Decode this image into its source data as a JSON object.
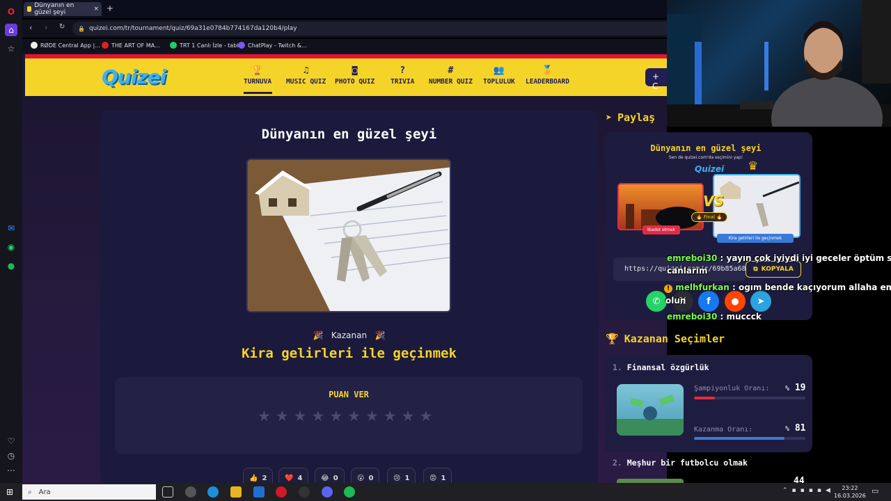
{
  "browser": {
    "tab_title": "Dünyanın en güzel şeyi",
    "url": "quizei.com/tr/tournament/quiz/69a31e0784b774167da120b4/play",
    "bookmarks": [
      "RØDE Central App |...",
      "THE ART OF MA...",
      "TRT 1 Canlı İzle - tabii",
      "ChatPlay - Twitch &..."
    ]
  },
  "site": {
    "logo": "Quizei",
    "nav": [
      {
        "icon": "trophy-icon",
        "glyph": "🏆",
        "label": "TURNUVA"
      },
      {
        "icon": "music-icon",
        "glyph": "♫",
        "label": "MUSIC QUIZ"
      },
      {
        "icon": "camera-icon",
        "glyph": "◙",
        "label": "PHOTO QUIZ"
      },
      {
        "icon": "question-icon",
        "glyph": "?",
        "label": "TRIVIA"
      },
      {
        "icon": "hash-icon",
        "glyph": "#",
        "label": "NUMBER QUIZ"
      },
      {
        "icon": "users-icon",
        "glyph": "👥",
        "label": "TOPLULUK"
      },
      {
        "icon": "medal-icon",
        "glyph": "🏅",
        "label": "LEADERBOARD"
      }
    ],
    "create_glyph": "+ C"
  },
  "quiz": {
    "title": "Dünyanın en güzel şeyi",
    "winner_label": "Kazanan",
    "winner": "Kira gelirleri ile geçinmek",
    "rate_label": "PUAN VER",
    "stars": 10,
    "reactions": [
      {
        "emoji": "👍",
        "count": "2"
      },
      {
        "emoji": "❤️",
        "count": "4"
      },
      {
        "emoji": "😂",
        "count": "0"
      },
      {
        "emoji": "😮",
        "count": "0"
      },
      {
        "emoji": "😢",
        "count": "1"
      },
      {
        "emoji": "😡",
        "count": "1"
      }
    ]
  },
  "share": {
    "header": "Paylaş",
    "preview_title": "Dünyanın en güzel şeyi",
    "preview_subtitle": "Sen de quizei.com'da seçimini yap!",
    "preview_logo": "Quizei",
    "vs": "VS",
    "final_badge": "🔥 Final 🔥",
    "left_label": "İbadet etmek",
    "right_label": "Kira gelirleri ile geçinmek",
    "link": "https://quizei.com/r/69b85a68",
    "copy_label": "KOPYALA",
    "colors": {
      "whatsapp": "#25d366",
      "x": "#2b2b33",
      "facebook": "#1877f2",
      "reddit": "#ff4500",
      "telegram": "#2aa3de"
    }
  },
  "winners": {
    "header": "Kazanan Seçimler",
    "items": [
      {
        "rank": "1.",
        "name": "Finansal özgürlük",
        "champ_label": "Şampiyonluk Oranı:",
        "champ_value": "19",
        "champ_pct": 19,
        "win_label": "Kazanma Oranı:",
        "win_value": "81",
        "win_pct": 81,
        "pct_sign": "%"
      },
      {
        "rank": "2.",
        "name": "Meşhur bir futbolcu olmak",
        "partial_value": "44"
      }
    ]
  },
  "chat": [
    {
      "user": "emreboi30",
      "text": " : yayın çok iyiydi iyi geceler öptüm sizi"
    },
    {
      "user": "",
      "text": "canlarım"
    },
    {
      "user": "melhfurkan",
      "text": " : ogım bende kaçıyorum allaha emanet"
    },
    {
      "user": "",
      "text": "olun"
    },
    {
      "user": "emreboi30",
      "text": " : muccck"
    }
  ],
  "taskbar": {
    "search_placeholder": "Ara",
    "time": "23:22",
    "date": "16.03.2026"
  }
}
